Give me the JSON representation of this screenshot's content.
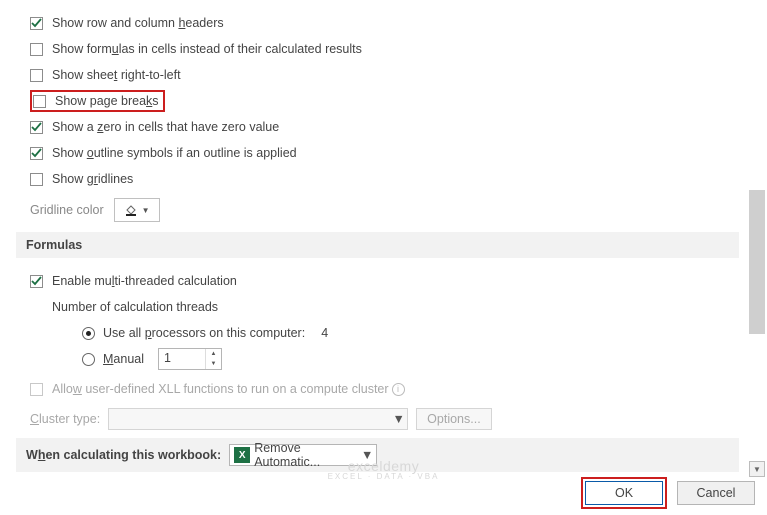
{
  "display_options": {
    "show_headers": {
      "label": "Show row and column headers",
      "checked": true
    },
    "show_formulas": {
      "label": "Show formulas in cells instead of their calculated results",
      "checked": false
    },
    "show_rtl": {
      "label": "Show sheet right-to-left",
      "checked": false
    },
    "show_page_breaks": {
      "label": "Show page breaks",
      "checked": false
    },
    "show_zero": {
      "label": "Show a zero in cells that have zero value",
      "checked": true
    },
    "show_outline": {
      "label": "Show outline symbols if an outline is applied",
      "checked": true
    },
    "show_gridlines": {
      "label": "Show gridlines",
      "checked": false
    },
    "gridline_color_label": "Gridline color"
  },
  "formulas_section": {
    "header": "Formulas",
    "enable_multithread": {
      "label": "Enable multi-threaded calculation",
      "checked": true
    },
    "threads_label": "Number of calculation threads",
    "use_all_label": "Use all processors on this computer:",
    "processor_count": "4",
    "manual_label": "Manual",
    "manual_value": "1",
    "xll_label": "Allow user-defined XLL functions to run on a compute cluster",
    "cluster_label": "Cluster type:",
    "options_btn": "Options..."
  },
  "workbook_section": {
    "label": "When calculating this workbook:",
    "value": "Remove Automatic..."
  },
  "footer": {
    "ok": "OK",
    "cancel": "Cancel"
  },
  "watermark": {
    "main": "exceldemy",
    "sub": "EXCEL · DATA · VBA"
  }
}
